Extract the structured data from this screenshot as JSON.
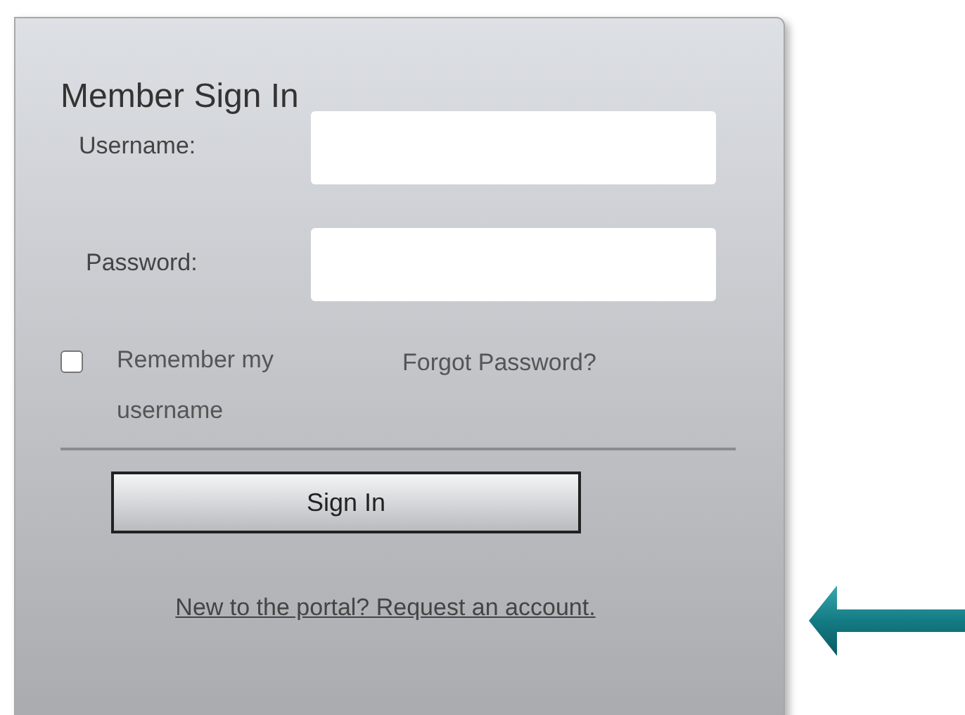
{
  "panel": {
    "title": "Member Sign In"
  },
  "fields": [
    {
      "label": "Username:"
    },
    {
      "label": "Password:"
    }
  ],
  "remember": {
    "label": "Remember my username",
    "checked": false
  },
  "forgot_link": "Forgot Password?",
  "sign_in_button": "Sign In",
  "request_link": "New to the portal? Request an account."
}
